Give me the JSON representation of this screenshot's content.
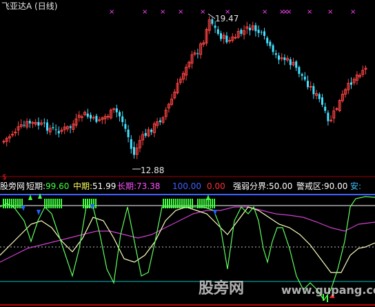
{
  "main_panel": {
    "title": "飞亚达A (日线)",
    "high_label": "19.47",
    "low_label": "12.88",
    "signal_mark": "$",
    "colors": {
      "up": "#ff4444",
      "down": "#44e0ff",
      "marker": "#ff44ff",
      "axis": "#c00000"
    }
  },
  "indicator_panel": {
    "name": "股旁网",
    "items": [
      {
        "label": "短期:",
        "value": "99.60",
        "label_color": "#ffffff",
        "value_color": "#40ff40"
      },
      {
        "label": "中期:",
        "value": "51.99",
        "label_color": "#ffff60",
        "value_color": "#ffffff"
      },
      {
        "label": "长期:",
        "value": "73.38",
        "label_color": "#ff50ff",
        "value_color": "#ff50ff"
      },
      {
        "label": "",
        "value": "100.00",
        "label_color": "#4060ff",
        "value_color": "#4060ff"
      },
      {
        "label": "",
        "value": "0.00",
        "label_color": "#ff3030",
        "value_color": "#ff3030"
      },
      {
        "label": "强弱分界:",
        "value": "50.00",
        "label_color": "#ffffff",
        "value_color": "#ffffff"
      },
      {
        "label": "警戒区:",
        "value": "90.00",
        "label_color": "#ffffff",
        "value_color": "#ffffff"
      },
      {
        "label": "安:",
        "value": "",
        "label_color": "#40c0ff",
        "value_color": "#40c0ff"
      }
    ],
    "line_colors": {
      "short": "#60ff60",
      "mid": "#ffffc0",
      "long": "#d040d0",
      "upper": "#4060ff",
      "warn": "#ffffff",
      "base": "#00c0c0"
    }
  },
  "watermark": {
    "cn": "股旁网",
    "url": "www.gupang.com"
  }
}
